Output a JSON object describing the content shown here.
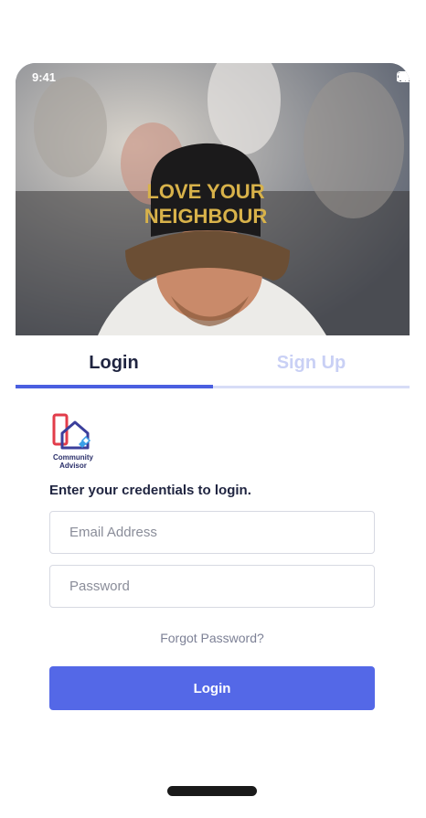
{
  "status_bar": {
    "time": "9:41"
  },
  "hero": {
    "cap_text_line1": "LOVE YOUR",
    "cap_text_line2": "NEIGHBOUR"
  },
  "tabs": [
    {
      "label": "Login",
      "active": true
    },
    {
      "label": "Sign Up",
      "active": false
    }
  ],
  "brand": {
    "line1": "Community",
    "line2": "Advisor"
  },
  "form": {
    "heading": "Enter your credentials to login.",
    "email_placeholder": "Email Address",
    "password_placeholder": "Password",
    "forgot_label": "Forgot Password?",
    "submit_label": "Login"
  },
  "colors": {
    "accent": "#5468e7",
    "tab_inactive": "#c9d0f5",
    "text": "#1f2440"
  }
}
